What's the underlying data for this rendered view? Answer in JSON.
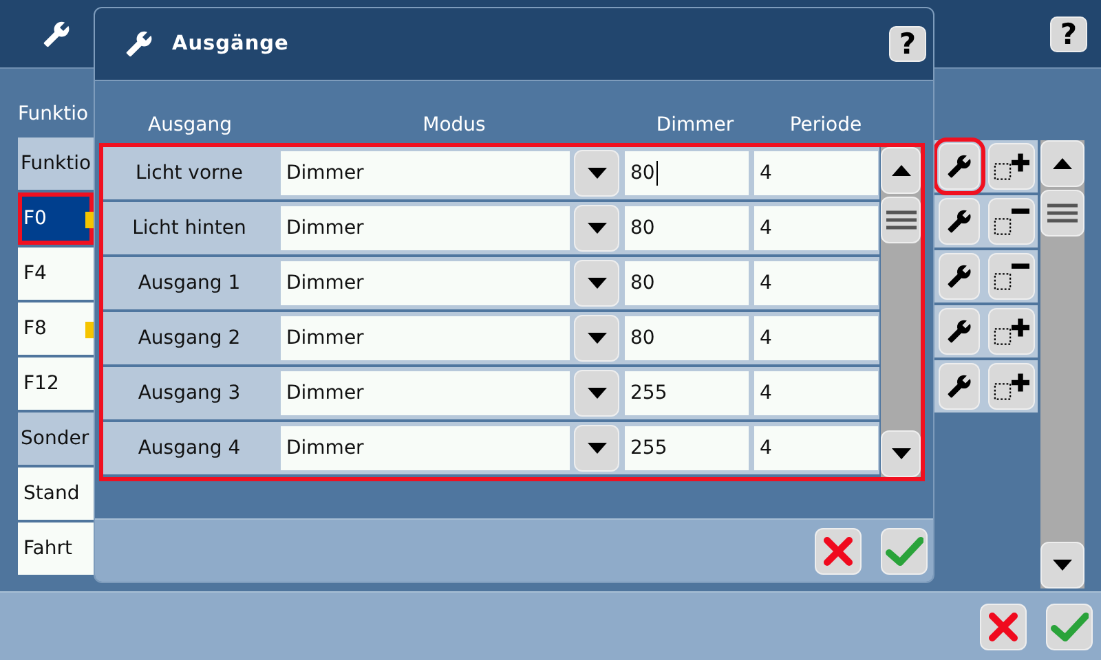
{
  "window": {
    "help": "?"
  },
  "functions": {
    "label": "Funktio",
    "items": [
      {
        "kind": "header",
        "text": "Funktio",
        "selected": false,
        "highlighted": false,
        "lamp": false
      },
      {
        "kind": "item",
        "text": "F0",
        "selected": true,
        "highlighted": true,
        "lamp": true
      },
      {
        "kind": "item",
        "text": "F4",
        "selected": false,
        "highlighted": false,
        "lamp": false
      },
      {
        "kind": "item",
        "text": "F8",
        "selected": false,
        "highlighted": false,
        "lamp": true
      },
      {
        "kind": "item",
        "text": "F12",
        "selected": false,
        "highlighted": false,
        "lamp": false
      },
      {
        "kind": "header",
        "text": "Sonder",
        "selected": false,
        "highlighted": false,
        "lamp": false
      },
      {
        "kind": "item",
        "text": "Stand",
        "selected": false,
        "highlighted": false,
        "lamp": false
      },
      {
        "kind": "item",
        "text": "Fahrt",
        "selected": false,
        "highlighted": false,
        "lamp": false
      }
    ]
  },
  "row_actions": [
    {
      "kind": "add",
      "highlighted": true
    },
    {
      "kind": "remove",
      "highlighted": false
    },
    {
      "kind": "remove",
      "highlighted": false
    },
    {
      "kind": "add",
      "highlighted": false
    },
    {
      "kind": "add",
      "highlighted": false
    }
  ],
  "dialog": {
    "title": "Ausgänge",
    "help": "?",
    "table_highlighted": true,
    "columns": [
      "Ausgang",
      "Modus",
      "Dimmer",
      "Periode"
    ],
    "rows": [
      {
        "name": "Licht vorne",
        "mode": "Dimmer",
        "dimmer": "80",
        "period": "4",
        "focused": true
      },
      {
        "name": "Licht hinten",
        "mode": "Dimmer",
        "dimmer": "80",
        "period": "4",
        "focused": false
      },
      {
        "name": "Ausgang 1",
        "mode": "Dimmer",
        "dimmer": "80",
        "period": "4",
        "focused": false
      },
      {
        "name": "Ausgang 2",
        "mode": "Dimmer",
        "dimmer": "80",
        "period": "4",
        "focused": false
      },
      {
        "name": "Ausgang 3",
        "mode": "Dimmer",
        "dimmer": "255",
        "period": "4",
        "focused": false
      },
      {
        "name": "Ausgang 4",
        "mode": "Dimmer",
        "dimmer": "255",
        "period": "4",
        "focused": false
      }
    ]
  }
}
